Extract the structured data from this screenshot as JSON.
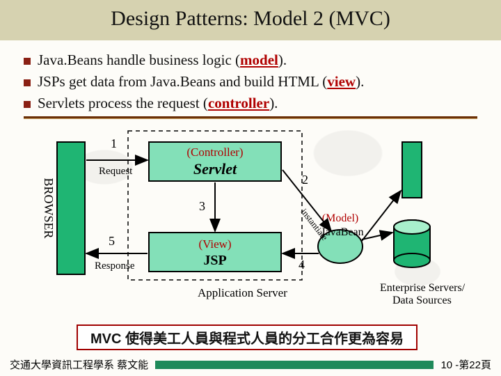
{
  "header": {
    "title": "Design Patterns: Model 2 (MVC)"
  },
  "bullets": [
    {
      "pre": "Java.Beans handle business logic (",
      "u": "model",
      "post": ")."
    },
    {
      "pre": "JSPs get data from Java.Beans and build HTML (",
      "u": "view",
      "post": ")."
    },
    {
      "pre": "Servlets process the request (",
      "u": "controller",
      "post": ")."
    }
  ],
  "diagram": {
    "browser": "BROWSER",
    "controller_role": "(Controller)",
    "controller_name": "Servlet",
    "view_role": "(View)",
    "view_name": "JSP",
    "model_role": "(Model)",
    "model_name": "JavaBean",
    "num1": "1",
    "num2": "2",
    "num3": "3",
    "num4": "4",
    "num5": "5",
    "request": "Request",
    "response": "Response",
    "instantiate": "instantiate",
    "app_server": "Application Server",
    "enterprise": "Enterprise Servers/\nData Sources"
  },
  "caption": "MVC 使得美工人員與程式人員的分工合作更為容易",
  "footer": {
    "left": "交通大學資訊工程學系  蔡文能",
    "right": "10 -第22頁"
  }
}
